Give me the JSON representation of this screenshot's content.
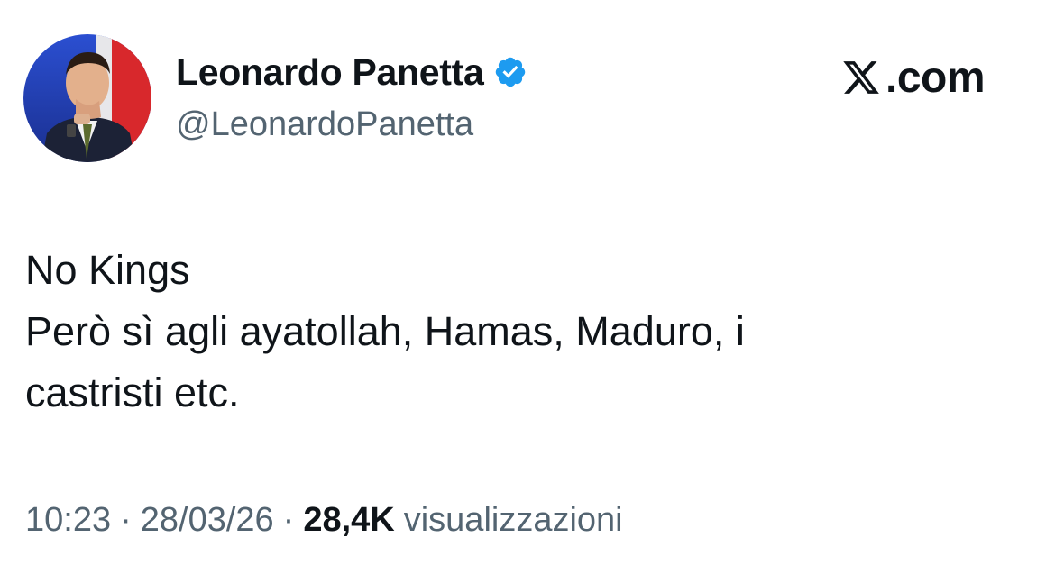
{
  "tweet": {
    "author": {
      "name": "Leonardo Panetta",
      "handle": "@LeonardoPanetta",
      "verified_icon": "verified-badge-icon"
    },
    "brand": {
      "logo_icon": "x-logo-icon",
      "text": ".com"
    },
    "text_lines": [
      "No Kings",
      "Però sì agli ayatollah, Hamas, Maduro, i",
      "castristi etc."
    ],
    "meta": {
      "time": "10:23",
      "separator": "·",
      "date": "28/03/26",
      "views_count": "28,4K",
      "views_label": "visualizzazioni"
    }
  },
  "colors": {
    "primary_text": "#0f1419",
    "secondary_text": "#536471",
    "verified_blue": "#1d9bf0",
    "background": "#ffffff"
  }
}
